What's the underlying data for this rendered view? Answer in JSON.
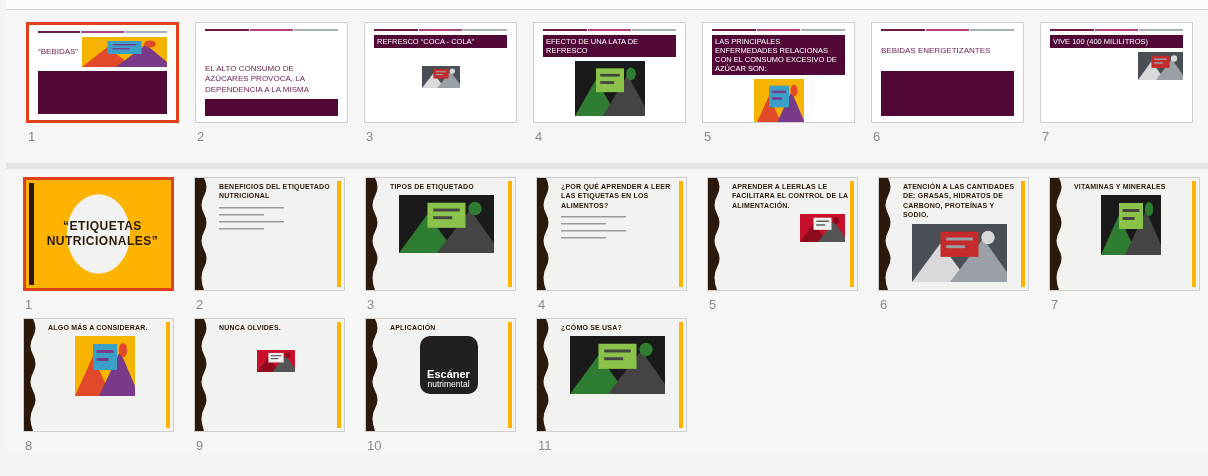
{
  "panes": [
    {
      "slides": [
        {
          "number": "1",
          "selected": true,
          "kind": "title_image",
          "title": "“BEBIDAS”"
        },
        {
          "number": "2",
          "selected": false,
          "kind": "title_low",
          "title": "EL ALTO CONSUMO DE AZÚCARES PROVOCA, LA DEPENDENCIA A LA MISMA"
        },
        {
          "number": "3",
          "selected": false,
          "kind": "header_small",
          "title": "REFRESCO  “COCA - COLA”"
        },
        {
          "number": "4",
          "selected": false,
          "kind": "header_large",
          "title": "EFECTO DE UNA LATA DE REFRESCO"
        },
        {
          "number": "5",
          "selected": false,
          "kind": "header_tall",
          "title": "LAS PRINCIPALES ENFERMEDADES RELACIONAS CON EL CONSUMO EXCESIVO DE AZÚCAR SON:"
        },
        {
          "number": "6",
          "selected": false,
          "kind": "title",
          "title": "BEBIDAS ENERGETIZANTES"
        },
        {
          "number": "7",
          "selected": false,
          "kind": "header_right",
          "title": "VIVE 100 (400 MILILITROS)"
        }
      ]
    },
    {
      "slides": [
        {
          "number": "1",
          "selected": true,
          "kind": "cover",
          "title": "“ETIQUETAS NUTRICIONALES”"
        },
        {
          "number": "2",
          "selected": false,
          "kind": "text",
          "title": "BENEFICIOS DEL ETIQUETADO NUTRICIONAL"
        },
        {
          "number": "3",
          "selected": false,
          "kind": "picture_wide",
          "title": "TIPOS DE ETIQUETADO"
        },
        {
          "number": "4",
          "selected": false,
          "kind": "text",
          "title": "¿POR QUÉ APRENDER A LEER LAS ETIQUETAS EN LOS ALIMENTOS?"
        },
        {
          "number": "5",
          "selected": false,
          "kind": "picture_right",
          "title": "APRENDER A LEERLAS LE FACILITARA EL CONTROL DE LA ALIMENTACIÓN."
        },
        {
          "number": "6",
          "selected": false,
          "kind": "picture_wide",
          "title": "ATENCIÓN A LAS CANTIDADES DE: GRASAS, HIDRATOS DE CARBONO, PROTEÍNAS Y SODIO."
        },
        {
          "number": "7",
          "selected": false,
          "kind": "picture_center",
          "title": "VITAMINAS Y MINERALES"
        },
        {
          "number": "8",
          "selected": false,
          "kind": "picture_center",
          "title": "ALGO MÁS A CONSIDERAR."
        },
        {
          "number": "9",
          "selected": false,
          "kind": "picture_small",
          "title": "NUNCA OLVIDES."
        },
        {
          "number": "10",
          "selected": false,
          "kind": "app",
          "title": "APLICACIÓN",
          "app_name": "Escáner",
          "app_subtitle": "nutrimental"
        },
        {
          "number": "11",
          "selected": false,
          "kind": "picture_wide",
          "title": "¿CÓMO SE USA?"
        }
      ]
    }
  ]
}
